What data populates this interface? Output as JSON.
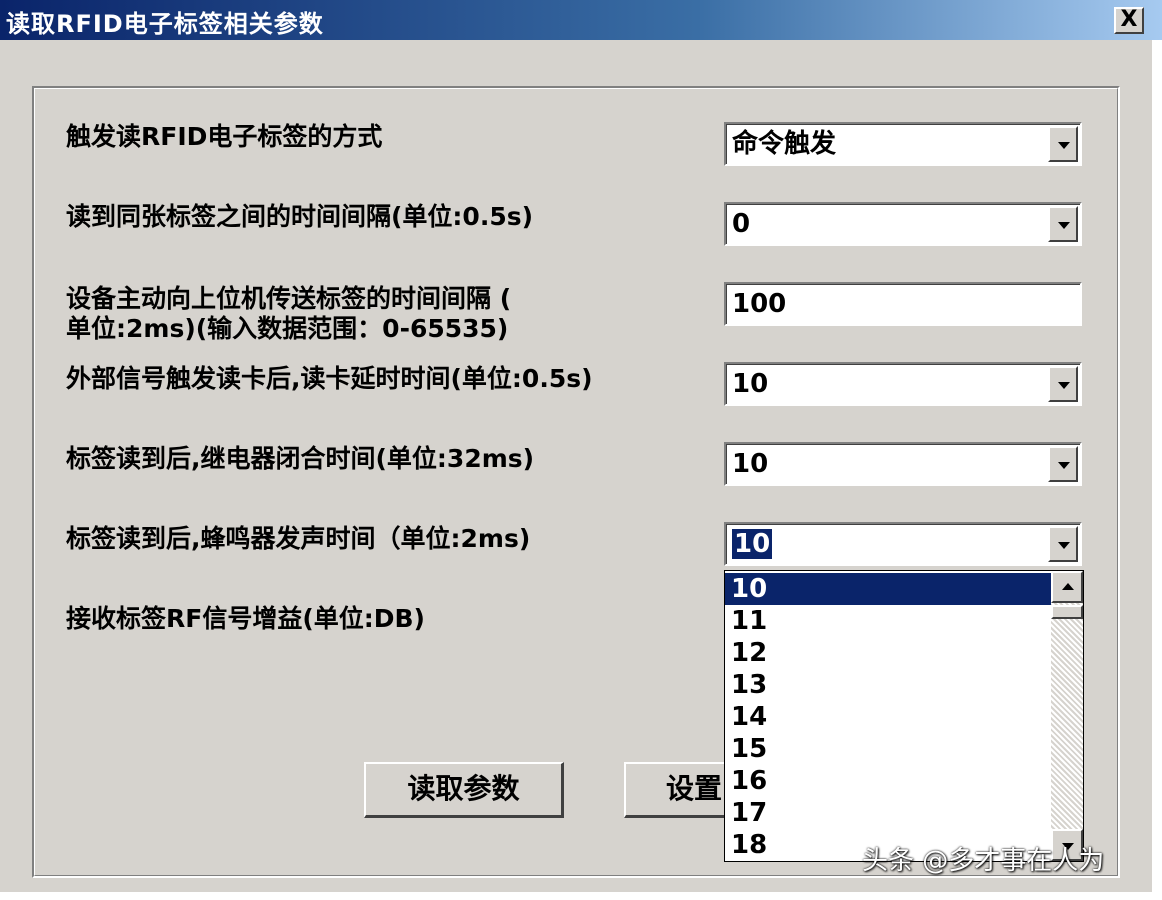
{
  "window": {
    "title": "读取RFID电子标签相关参数",
    "close_label": "X"
  },
  "form": {
    "rows": [
      {
        "label": "触发读RFID电子标签的方式",
        "value": "命令触发",
        "type": "dropdown"
      },
      {
        "label": "读到同张标签之间的时间间隔(单位:0.5s)",
        "value": "0",
        "type": "dropdown"
      },
      {
        "label_line1": "设备主动向上位机传送标签的时间间隔  (",
        "label_line2": "单位:2ms)(输入数据范围：0-65535)",
        "value": "100",
        "type": "text"
      },
      {
        "label": "外部信号触发读卡后,读卡延时时间(单位:0.5s)",
        "value": "10",
        "type": "dropdown"
      },
      {
        "label": "标签读到后,继电器闭合时间(单位:32ms)",
        "value": "10",
        "type": "dropdown"
      },
      {
        "label": "标签读到后,蜂鸣器发声时间（单位:2ms)",
        "value": "10",
        "type": "dropdown",
        "open": true
      },
      {
        "label": "接收标签RF信号增益(单位:DB)"
      }
    ]
  },
  "dropdown_list": {
    "options": [
      "10",
      "11",
      "12",
      "13",
      "14",
      "15",
      "16",
      "17",
      "18"
    ],
    "selected": "10"
  },
  "buttons": {
    "read": "读取参数",
    "set": "设置"
  },
  "watermark": "头条 @多才事在人为",
  "colors": {
    "titlebar_start": "#0a246a",
    "titlebar_end": "#a6caf0",
    "selection": "#0a246a",
    "dialog_bg": "#d6d3ce"
  }
}
